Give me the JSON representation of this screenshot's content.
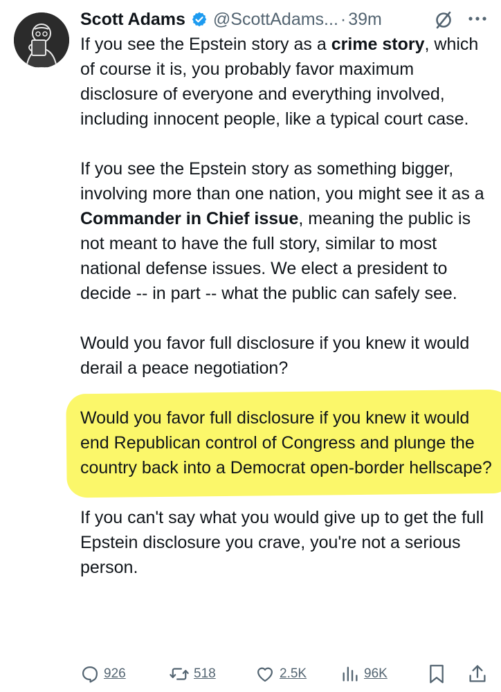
{
  "author": {
    "name": "Scott Adams",
    "handle": "@ScottAdams...",
    "separator": "·",
    "time": "39m",
    "verified_badge_color": "#1d9bf0",
    "avatar_icon": "avatar-coffee-mug-icon"
  },
  "post": {
    "p1": {
      "a": "If you see the Epstein story as a ",
      "b": "crime story",
      "c": ", which of course it is, you probably favor maximum disclosure of everyone and everything involved, including innocent people, like a typical court case."
    },
    "p2": {
      "a": "If you see the Epstein story as something bigger, involving more than one nation, you might see it as a ",
      "b": "Commander in Chief issue",
      "c": ", meaning the public is not meant to have the full story, similar to most national defense issues. We elect a president to decide -- in part -- what the public can safely see."
    },
    "p3": "Would you favor full disclosure if you knew it would derail a peace negotiation?",
    "p4": "Would you favor full disclosure if you knew it would end Republican control of Congress and plunge the country back into a Democrat open-border hellscape?",
    "p5": "If you can't say what you would give up to get the full Epstein disclosure you crave, you're not a serious person.",
    "highlight_color": "#fbf76a"
  },
  "actions": {
    "replies": "926",
    "reposts": "518",
    "likes": "2.5K",
    "views": "96K",
    "reply_icon": "reply-icon",
    "repost_icon": "repost-icon",
    "like_icon": "heart-icon",
    "views_icon": "views-icon",
    "bookmark_icon": "bookmark-icon",
    "share_icon": "share-icon"
  },
  "header_icons": {
    "grok": "grok-icon",
    "more": "more-icon"
  }
}
